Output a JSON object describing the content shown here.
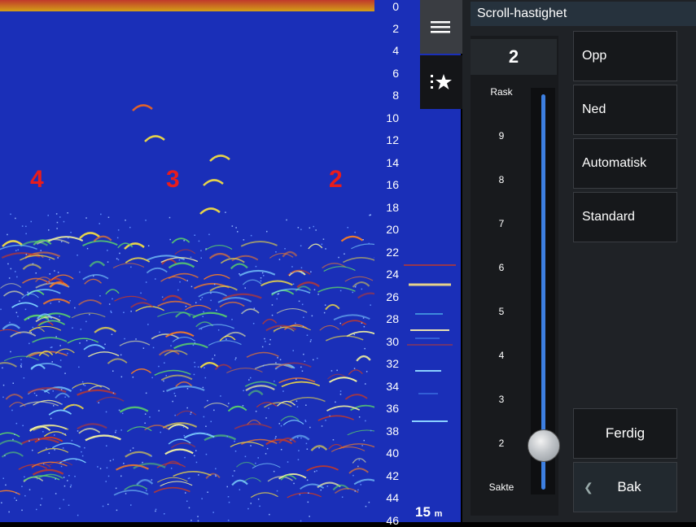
{
  "sonar": {
    "zone_labels": [
      "4",
      "3",
      "2"
    ],
    "depth_ticks": [
      "0",
      "2",
      "4",
      "6",
      "8",
      "10",
      "12",
      "14",
      "16",
      "18",
      "20",
      "22",
      "24",
      "26",
      "28",
      "30",
      "32",
      "34",
      "36",
      "38",
      "40",
      "42",
      "44",
      "46"
    ],
    "range_value": "15",
    "range_unit": "m"
  },
  "side_tabs": {
    "menu_icon": "menu-icon",
    "favorites_icon": "favorites-star-icon"
  },
  "panel": {
    "title": "Scroll-hastighet",
    "current_value": "2",
    "slider_value": 2,
    "slider_max_label": "Rask",
    "slider_min_label": "Sakte",
    "slider_ticks": [
      "9",
      "8",
      "7",
      "6",
      "5",
      "4",
      "3",
      "2"
    ],
    "buttons": {
      "up": "Opp",
      "down": "Ned",
      "automatic": "Automatisk",
      "standard": "Standard",
      "done": "Ferdig",
      "back": "Bak"
    }
  },
  "colors": {
    "sonar_background": "#1a2fb8",
    "track": "#3d7fe0",
    "zone_label": "#e81c1c"
  }
}
